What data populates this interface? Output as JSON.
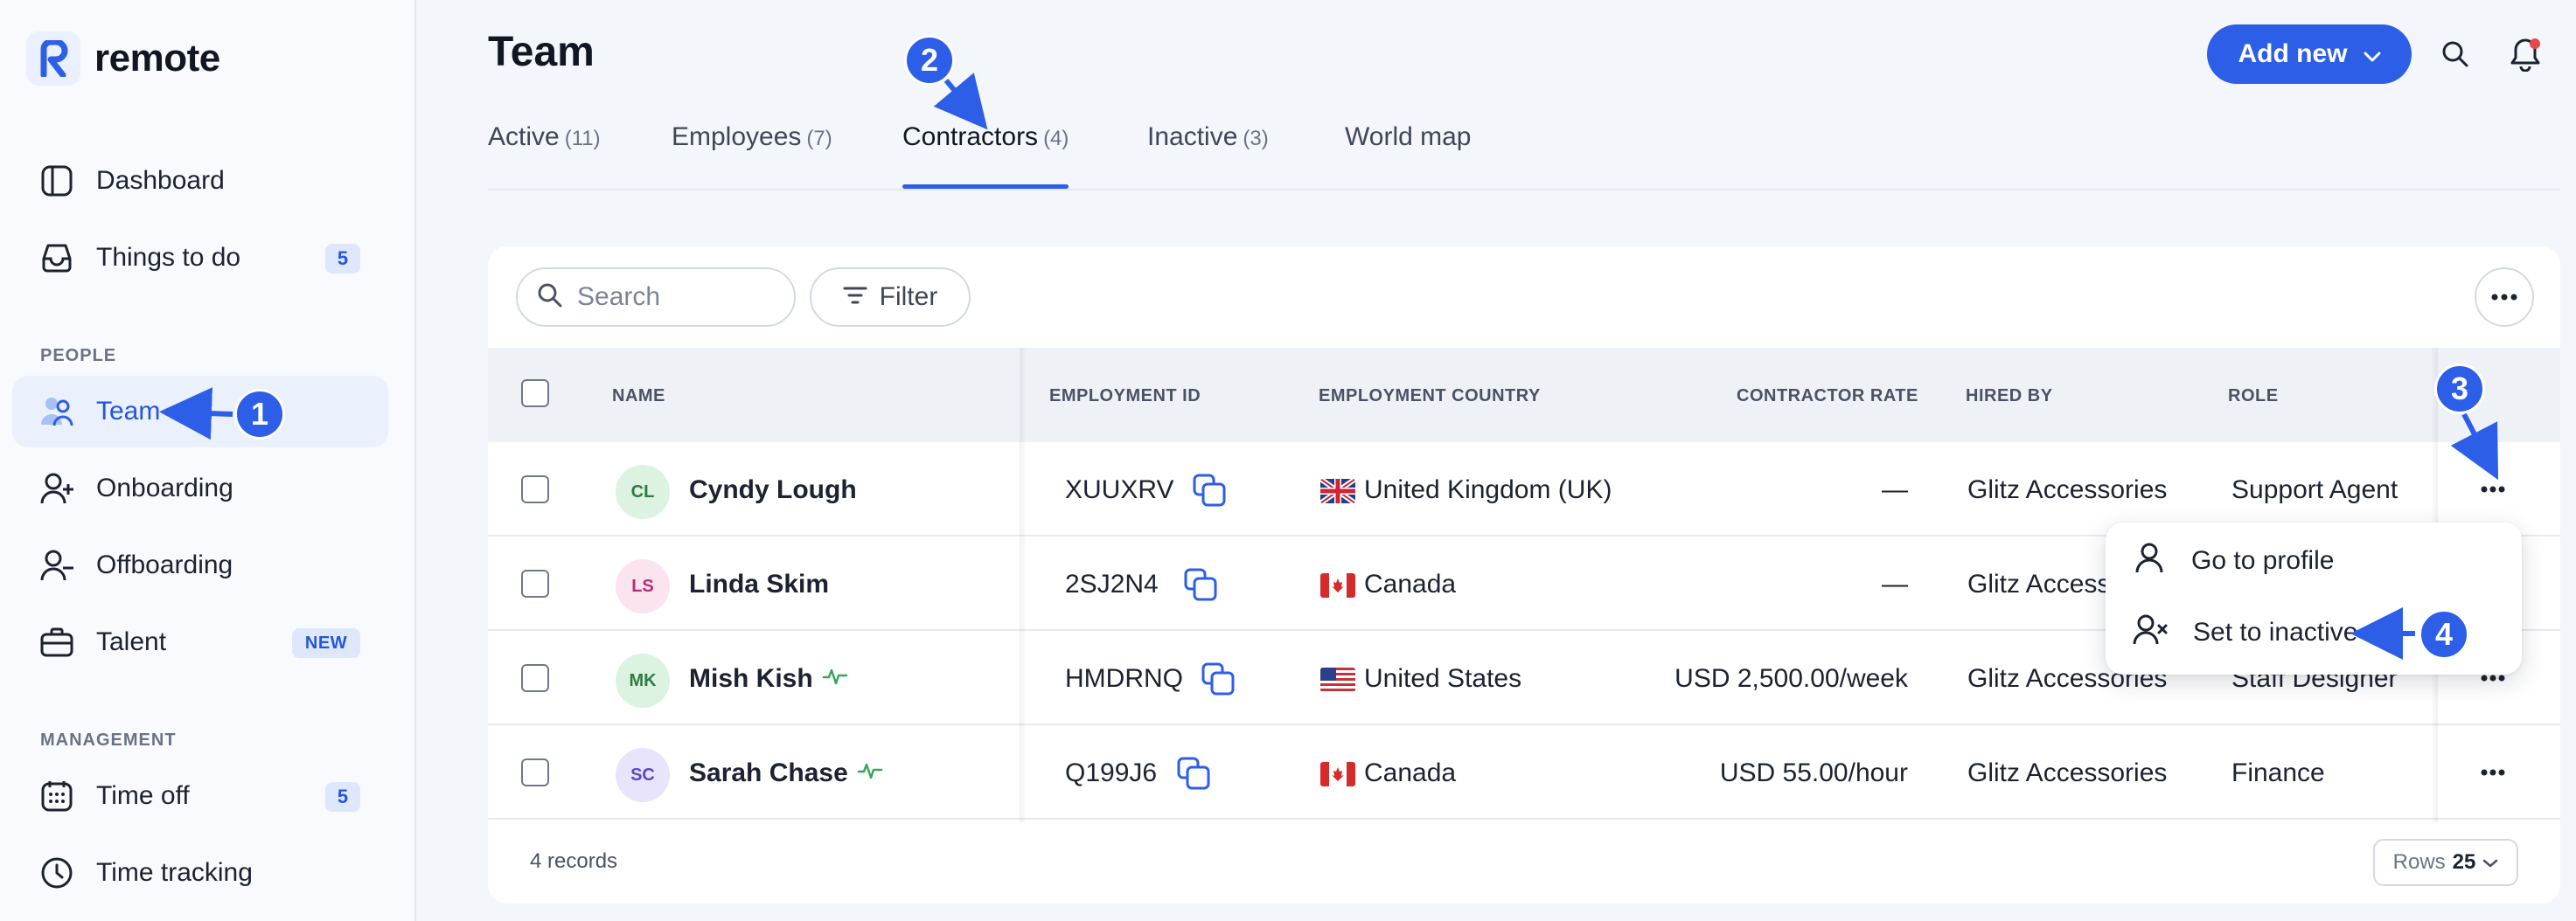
{
  "brand": {
    "name": "remote"
  },
  "sidebar": {
    "items": [
      {
        "label": "Dashboard"
      },
      {
        "label": "Things to do",
        "badge": "5"
      },
      {
        "label": "Team"
      },
      {
        "label": "Onboarding"
      },
      {
        "label": "Offboarding"
      },
      {
        "label": "Talent",
        "badge": "NEW"
      },
      {
        "label": "Time off",
        "badge": "5"
      },
      {
        "label": "Time tracking"
      }
    ],
    "sections": {
      "people": "PEOPLE",
      "management": "MANAGEMENT"
    }
  },
  "header": {
    "title": "Team",
    "add_new_label": "Add new"
  },
  "tabs": [
    {
      "label": "Active",
      "count": "(11)"
    },
    {
      "label": "Employees",
      "count": "(7)"
    },
    {
      "label": "Contractors",
      "count": "(4)",
      "active": true
    },
    {
      "label": "Inactive",
      "count": "(3)"
    },
    {
      "label": "World map",
      "count": ""
    }
  ],
  "toolbar": {
    "search_placeholder": "Search",
    "filter_label": "Filter"
  },
  "table": {
    "columns": {
      "name": "NAME",
      "employment_id": "EMPLOYMENT ID",
      "country": "EMPLOYMENT COUNTRY",
      "rate": "CONTRACTOR RATE",
      "hired_by": "HIRED BY",
      "role": "ROLE"
    },
    "rows": [
      {
        "initials": "CL",
        "name": "Cyndy Lough",
        "id": "XUUXRV",
        "country": "United Kingdom (UK)",
        "flag": "uk",
        "rate": "—",
        "hired_by": "Glitz Accessories",
        "role": "Support Agent",
        "active_icon": false
      },
      {
        "initials": "LS",
        "name": "Linda Skim",
        "id": "2SJ2N4",
        "country": "Canada",
        "flag": "ca",
        "rate": "—",
        "hired_by": "Glitz Access",
        "role": "",
        "active_icon": false
      },
      {
        "initials": "MK",
        "name": "Mish Kish",
        "id": "HMDRNQ",
        "country": "United States",
        "flag": "us",
        "rate": "USD 2,500.00/week",
        "hired_by": "Glitz Accessories",
        "role": "Staff Designer",
        "active_icon": true
      },
      {
        "initials": "SC",
        "name": "Sarah Chase",
        "id": "Q199J6",
        "country": "Canada",
        "flag": "ca",
        "rate": "USD 55.00/hour",
        "hired_by": "Glitz Accessories",
        "role": "Finance",
        "active_icon": true
      }
    ],
    "records": "4 records",
    "rows_label": "Rows",
    "rows_value": "25"
  },
  "dropdown": {
    "items": [
      {
        "label": "Go to profile"
      },
      {
        "label": "Set to inactive"
      }
    ]
  },
  "annotations": {
    "m1": "1",
    "m2": "2",
    "m3": "3",
    "m4": "4"
  },
  "colors": {
    "accent": "#2d5ee8",
    "badge_bg": "#dfe8fb"
  }
}
